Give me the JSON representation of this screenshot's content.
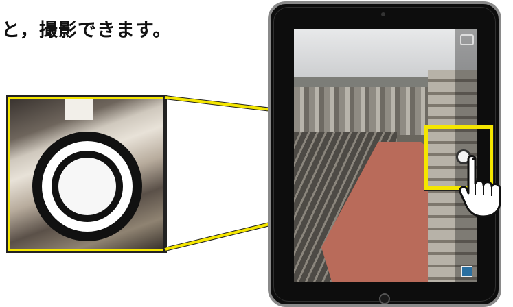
{
  "instruction": "と，撮影できます。",
  "icons": {
    "shutter": "camera-shutter-icon",
    "hand": "tap-hand-icon",
    "home": "home-button-icon",
    "switch": "camera-switch-icon"
  },
  "colors": {
    "highlight": "#f4e600",
    "outline": "#222222"
  }
}
